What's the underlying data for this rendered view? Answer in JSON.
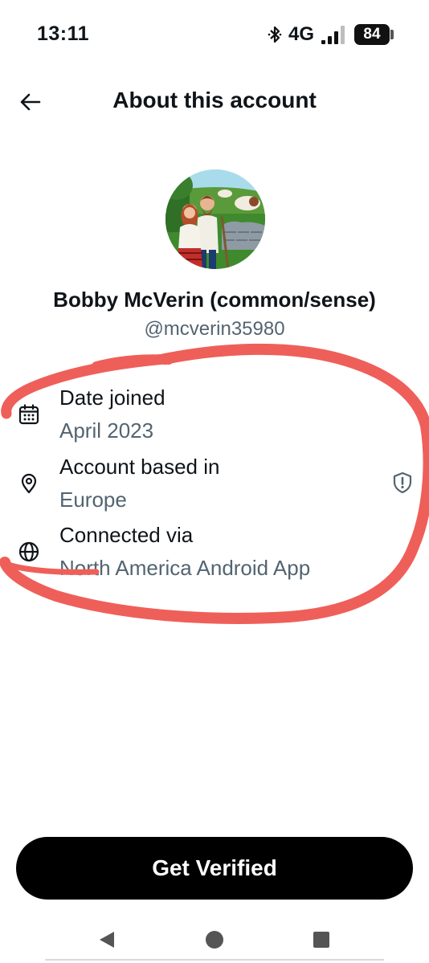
{
  "status_bar": {
    "time": "13:11",
    "network": "4G",
    "battery": "84",
    "icons": [
      "bluetooth-icon",
      "signal-icon",
      "battery-icon"
    ]
  },
  "header": {
    "title": "About this account",
    "back_icon": "arrow-left-icon"
  },
  "profile": {
    "display_name": "Bobby McVerin (common/sense)",
    "handle": "@mcverin35980"
  },
  "info": {
    "date_joined": {
      "label": "Date joined",
      "value": "April 2023",
      "icon": "calendar-icon"
    },
    "account_based_in": {
      "label": "Account based in",
      "value": "Europe",
      "icon": "location-pin-icon",
      "badge_icon": "shield-alert-icon"
    },
    "connected_via": {
      "label": "Connected via",
      "value": "North America Android App",
      "icon": "globe-icon"
    }
  },
  "cta": {
    "label": "Get Verified"
  },
  "nav": {
    "icons": [
      "back-triangle-icon",
      "home-circle-icon",
      "recents-square-icon"
    ]
  },
  "colors": {
    "primary_text": "#0f1419",
    "secondary_text": "#536471",
    "button_bg": "#000000",
    "annotation_stroke": "#ef5f59"
  }
}
